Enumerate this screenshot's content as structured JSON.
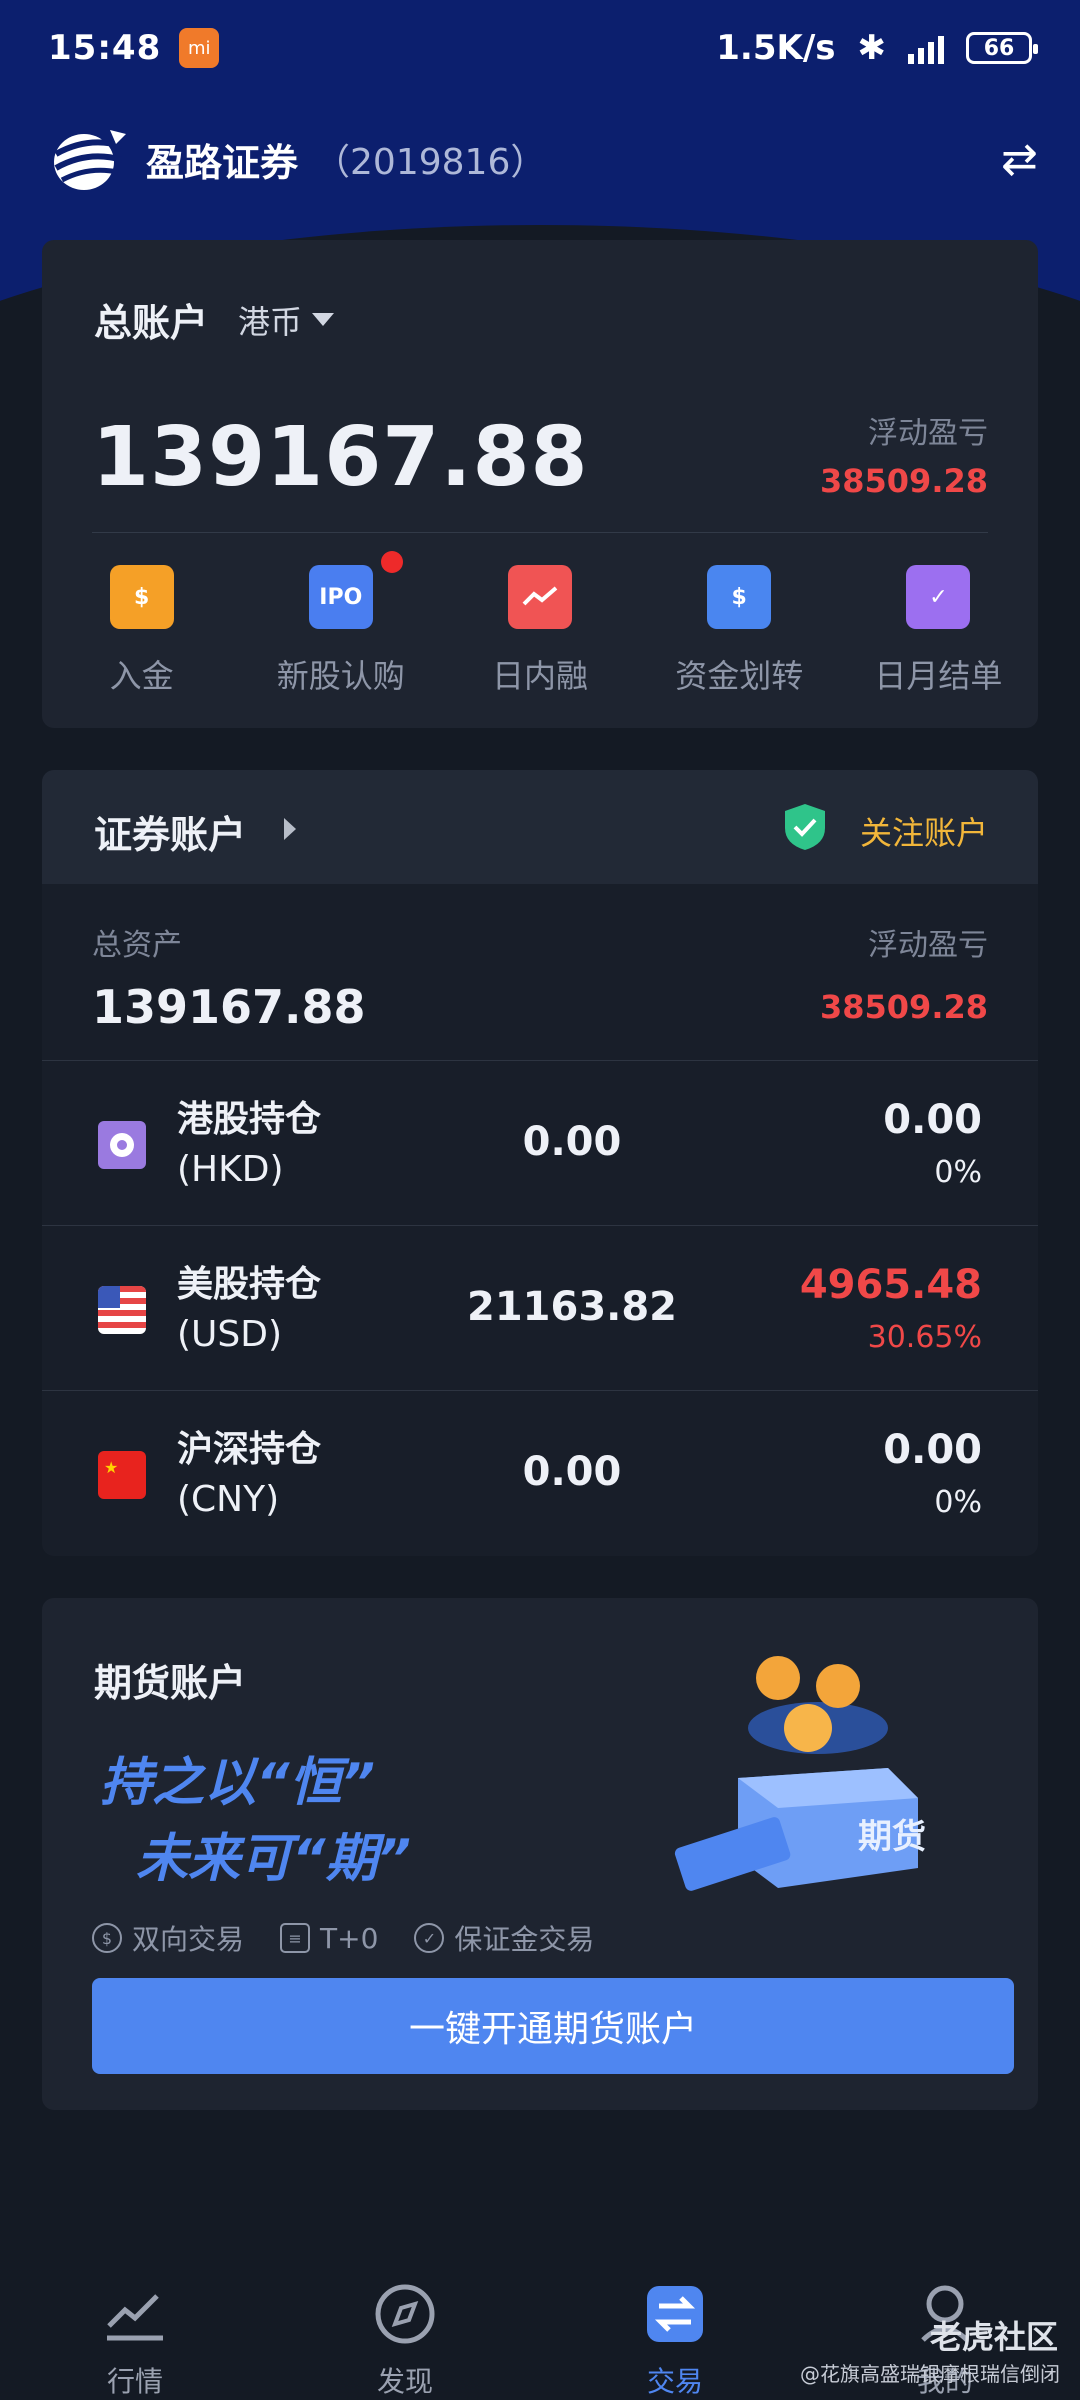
{
  "status_bar": {
    "time": "15:48",
    "net_speed": "1.5K/s",
    "battery": "66",
    "app_badge": "mi"
  },
  "header": {
    "brand": "盈路证券",
    "account_id": "（2019816）"
  },
  "total_account": {
    "title": "总账户",
    "currency": "港币",
    "amount": "139167.88",
    "float_label": "浮动盈亏",
    "float_value": "38509.28"
  },
  "actions": [
    {
      "label": "入金",
      "icon": "deposit-icon",
      "color": "#f5a027"
    },
    {
      "label": "新股认购",
      "icon": "ipo-icon",
      "color": "#4a7ef0",
      "badge": true
    },
    {
      "label": "日内融",
      "icon": "intraday-icon",
      "color": "#f05454"
    },
    {
      "label": "资金划转",
      "icon": "transfer-icon",
      "color": "#4a86f0"
    },
    {
      "label": "日月结单",
      "icon": "statement-icon",
      "color": "#9c6ff0"
    }
  ],
  "securities": {
    "title": "证券账户",
    "follow_label": "关注账户",
    "asset_label": "总资产",
    "float_label": "浮动盈亏",
    "asset_value": "139167.88",
    "float_value": "38509.28",
    "positions": [
      {
        "name": "港股持仓",
        "code": "(HKD)",
        "value": "0.00",
        "pl": "0.00",
        "pct": "0%"
      },
      {
        "name": "美股持仓",
        "code": "(USD)",
        "value": "21163.82",
        "pl": "4965.48",
        "pct": "30.65%"
      },
      {
        "name": "沪深持仓",
        "code": "(CNY)",
        "value": "0.00",
        "pl": "0.00",
        "pct": "0%"
      }
    ]
  },
  "futures": {
    "title": "期货账户",
    "slogan_1": "持之以“恒”",
    "slogan_2": "未来可“期”",
    "features": [
      "双向交易",
      "T+0",
      "保证金交易"
    ],
    "button": "一键开通期货账户",
    "illustration_label": "期货"
  },
  "nav": [
    {
      "label": "行情",
      "icon": "market-chart-icon"
    },
    {
      "label": "发现",
      "icon": "compass-icon"
    },
    {
      "label": "交易",
      "icon": "trade-swap-icon",
      "active": true
    },
    {
      "label": "我的",
      "icon": "profile-icon"
    }
  ],
  "watermark": {
    "brand": "老虎社区",
    "text": "@花旗高盛瑞银摩根瑞信倒闭"
  }
}
